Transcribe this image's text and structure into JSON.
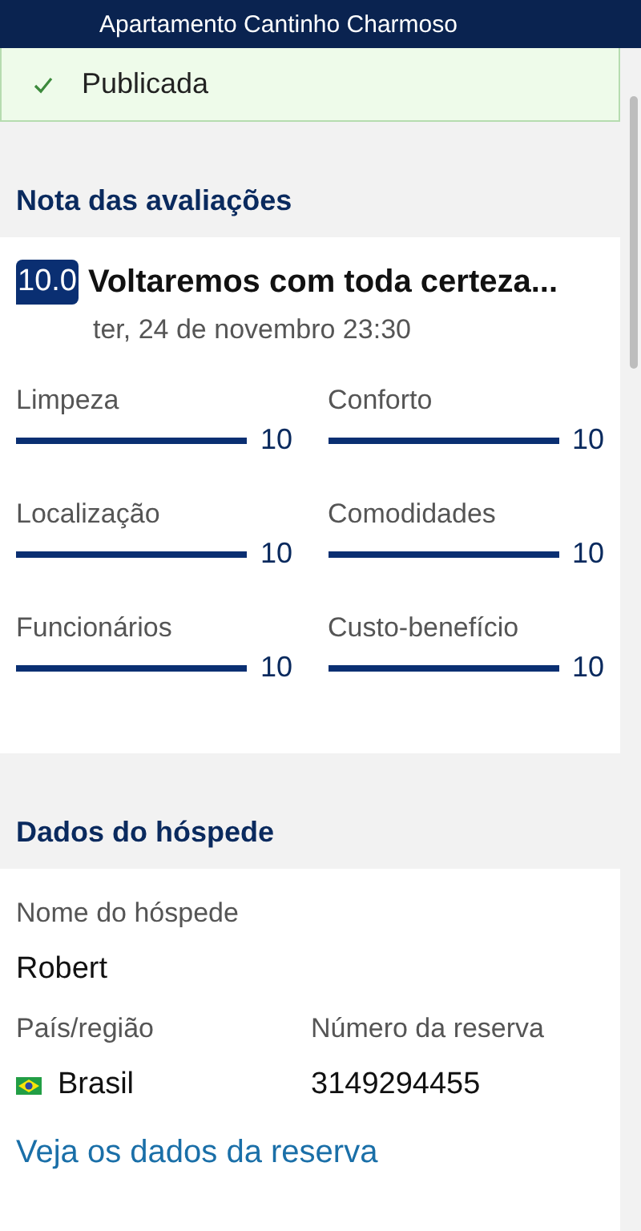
{
  "header": {
    "title": "Apartamento Cantinho Charmoso"
  },
  "status": {
    "label": "Publicada",
    "checked": true
  },
  "ratings_section": {
    "title": "Nota das avaliações"
  },
  "review": {
    "score": "10.0",
    "headline": "Voltaremos com toda certeza...",
    "date": "ter, 24 de novembro 23:30",
    "categories": [
      {
        "name": "Limpeza",
        "value": "10"
      },
      {
        "name": "Conforto",
        "value": "10"
      },
      {
        "name": "Localização",
        "value": "10"
      },
      {
        "name": "Comodidades",
        "value": "10"
      },
      {
        "name": "Funcionários",
        "value": "10"
      },
      {
        "name": "Custo-benefício",
        "value": "10"
      }
    ]
  },
  "guest_section": {
    "title": "Dados do hóspede"
  },
  "guest": {
    "name_label": "Nome do hóspede",
    "name": "Robert",
    "country_label": "País/região",
    "country": "Brasil",
    "booking_label": "Número da reserva",
    "booking_number": "3149294455",
    "link": "Veja os dados da reserva"
  }
}
